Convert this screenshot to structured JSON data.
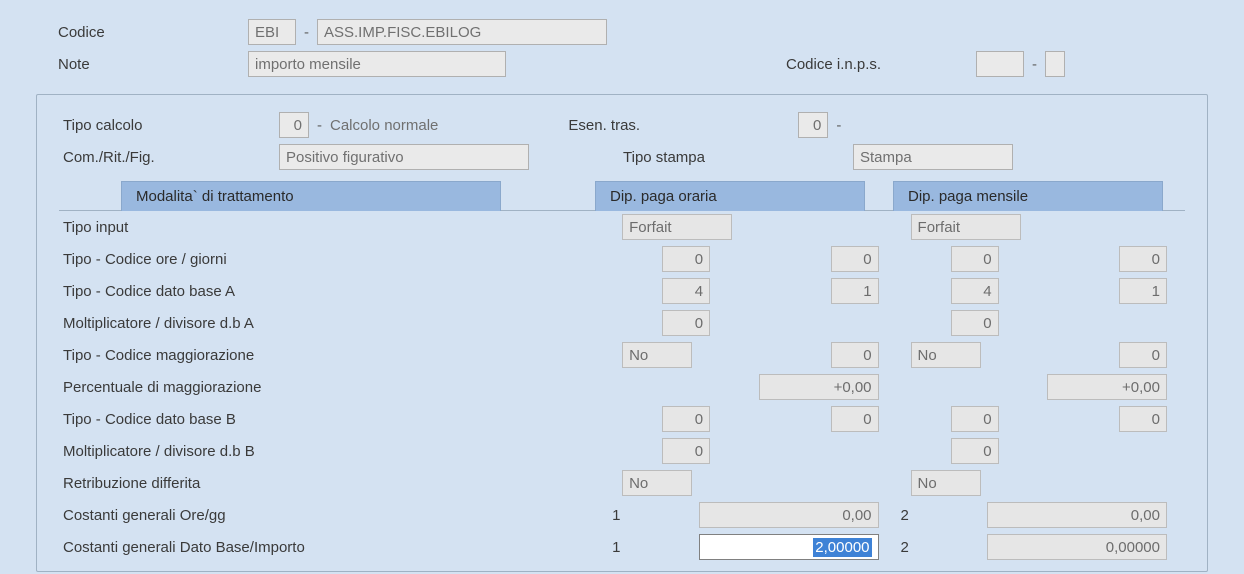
{
  "top": {
    "codice_label": "Codice",
    "codice_val": "EBI",
    "codice_desc": "ASS.IMP.FISC.EBILOG",
    "note_label": "Note",
    "note_val": "importo mensile",
    "inps_label": "Codice i.n.p.s.",
    "inps_val1": "",
    "inps_val2": ""
  },
  "header": {
    "tipo_calcolo_label": "Tipo calcolo",
    "tipo_calcolo_val": "0",
    "tipo_calcolo_desc": "Calcolo normale",
    "esen_tras_label": "Esen. tras.",
    "esen_tras_val": "0",
    "com_rit_label": "Com./Rit./Fig.",
    "com_rit_val": "Positivo figurativo",
    "tipo_stampa_label": "Tipo stampa",
    "tipo_stampa_val": "Stampa"
  },
  "tabs": {
    "t1": "Modalita` di trattamento",
    "t2": "Dip. paga oraria",
    "t3": "Dip. paga mensile"
  },
  "rows": {
    "tipo_input": {
      "label": "Tipo input",
      "o1": "Forfait",
      "m1": "Forfait"
    },
    "tipo_ore": {
      "label": "Tipo - Codice ore / giorni",
      "o1": "0",
      "o2": "0",
      "m1": "0",
      "m2": "0"
    },
    "tipo_da": {
      "label": "Tipo - Codice dato base A",
      "o1": "4",
      "o2": "1",
      "m1": "4",
      "m2": "1"
    },
    "molt_a": {
      "label": "Moltiplicatore / divisore d.b A",
      "o1": "0",
      "m1": "0"
    },
    "tipo_magg": {
      "label": "Tipo - Codice        maggiorazione",
      "o1": "No",
      "o2": "0",
      "m1": "No",
      "m2": "0"
    },
    "perc_magg": {
      "label": "Percentuale di maggiorazione",
      "o1": "+0,00",
      "m1": "+0,00"
    },
    "tipo_db": {
      "label": "Tipo - Codice dato base B",
      "o1": "0",
      "o2": "0",
      "m1": "0",
      "m2": "0"
    },
    "molt_b": {
      "label": "Moltiplicatore / divisore d.b B",
      "o1": "0",
      "m1": "0"
    },
    "retr_diff": {
      "label": "Retribuzione differita",
      "o1": "No",
      "m1": "No"
    },
    "cost_ore": {
      "label": "Costanti generali Ore/gg",
      "op": "1",
      "o1": "0,00",
      "mp": "2",
      "m1": "0,00"
    },
    "cost_db": {
      "label": "Costanti generali Dato Base/Importo",
      "op": "1",
      "o1": "2,00000",
      "mp": "2",
      "m1": "0,00000"
    }
  }
}
